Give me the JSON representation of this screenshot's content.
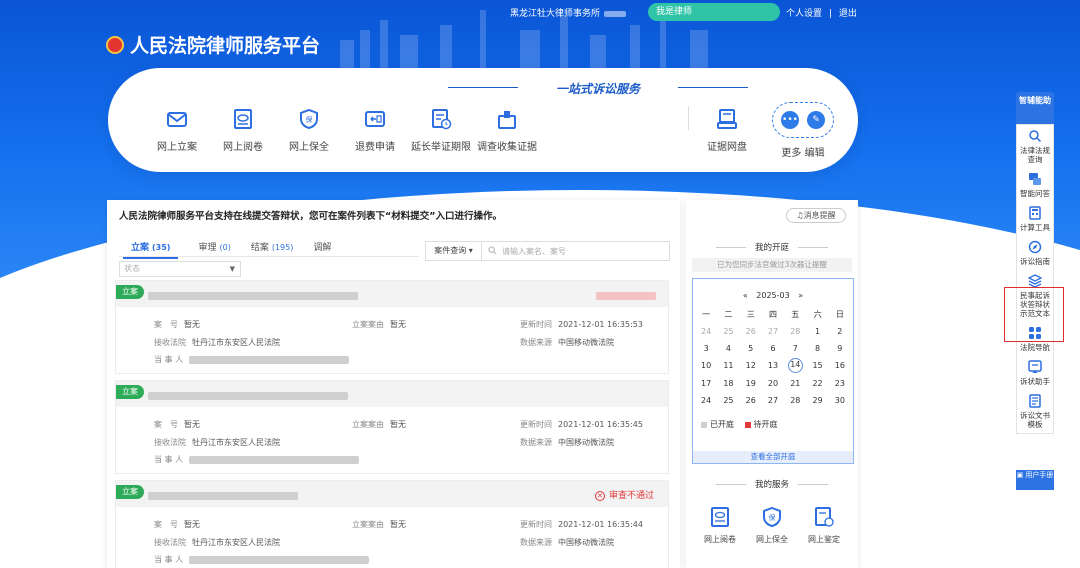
{
  "topbar": {
    "firm": "黑龙江牡大律师事务所",
    "role_button": "我是律师",
    "links": [
      "个人设置",
      "|",
      "退出"
    ]
  },
  "brand": {
    "title": "人民法院律师服务平台"
  },
  "services_card": {
    "slogan": "一站式诉讼服务",
    "items": [
      {
        "label": "网上立案",
        "icon": "envelope-icon"
      },
      {
        "label": "网上阅卷",
        "icon": "eye-document-icon"
      },
      {
        "label": "网上保全",
        "icon": "shield-icon"
      },
      {
        "label": "退费申请",
        "icon": "refund-icon"
      },
      {
        "label": "延长举证期限",
        "icon": "calendar-clock-icon"
      },
      {
        "label": "调查收集证据",
        "icon": "collect-evidence-icon"
      },
      {
        "label": "证据网盘",
        "icon": "cloud-disk-icon"
      }
    ],
    "more_label": "更多",
    "edit_label": "编辑"
  },
  "left_panel": {
    "notice": "人民法院律师服务平台支持在线提交答辩状，您可在案件列表下“材料提交”入口进行操作。",
    "tabs": [
      {
        "label": "立案",
        "count": "(35)"
      },
      {
        "label": "审理",
        "count": "(0)"
      },
      {
        "label": "结案",
        "count": "(195)"
      },
      {
        "label": "调解",
        "count": ""
      }
    ],
    "status_placeholder": "状态",
    "search_type": "案件查询 ▾",
    "search_placeholder": "请输入案名、案号",
    "field_labels": {
      "case_no": "案　号",
      "reason": "立案案由",
      "updated": "更新时间",
      "court": "接收法院",
      "source": "数据来源",
      "party": "当 事 人"
    },
    "cases": [
      {
        "badge": "立案",
        "case_no": "暂无",
        "reason": "暂无",
        "updated": "2021-12-01 16:35:53",
        "court": "牡丹江市东安区人民法院",
        "source": "中国移动微法院",
        "status": ""
      },
      {
        "badge": "立案",
        "case_no": "暂无",
        "reason": "暂无",
        "updated": "2021-12-01 16:35:45",
        "court": "牡丹江市东安区人民法院",
        "source": "中国移动微法院",
        "status": ""
      },
      {
        "badge": "立案",
        "case_no": "暂无",
        "reason": "暂无",
        "updated": "2021-12-01 16:35:44",
        "court": "牡丹江市东安区人民法院",
        "source": "中国移动微法院",
        "status": "审查不通过"
      }
    ]
  },
  "right_panel": {
    "message_button": "消息提醒",
    "hearing_title": "我的开庭",
    "hearing_note": "已为您同步法官做过3次器让提醒",
    "calendar": {
      "prev": "«",
      "month": "2025-03",
      "next": "»",
      "weekdays": [
        "一",
        "二",
        "三",
        "四",
        "五",
        "六",
        "日"
      ],
      "days": [
        "24",
        "25",
        "26",
        "27",
        "28",
        "1",
        "2",
        "3",
        "4",
        "5",
        "6",
        "7",
        "8",
        "9",
        "10",
        "11",
        "12",
        "13",
        "14",
        "15",
        "16",
        "17",
        "18",
        "19",
        "20",
        "21",
        "22",
        "23",
        "24",
        "25",
        "26",
        "27",
        "28",
        "29",
        "30"
      ],
      "today": "14",
      "legend_open": "已开庭",
      "legend_pending": "待开庭",
      "view_all": "查看全部开庭"
    },
    "services_title": "我的服务",
    "services": [
      {
        "label": "网上阅卷",
        "icon": "read-file-icon"
      },
      {
        "label": "网上保全",
        "icon": "shield-icon"
      },
      {
        "label": "网上鉴定",
        "icon": "appraisal-icon"
      }
    ]
  },
  "sidebar": {
    "head": "智辅能助",
    "items": [
      {
        "label": "法律法规查询",
        "icon": "search-icon"
      },
      {
        "label": "智能问答",
        "icon": "chat-icon"
      },
      {
        "label": "计算工具",
        "icon": "calculator-icon"
      },
      {
        "label": "诉讼指南",
        "icon": "compass-icon"
      },
      {
        "label": "民事起诉状答辩状示范文本",
        "icon": "layers-icon"
      },
      {
        "label": "法院导航",
        "icon": "grid-icon"
      },
      {
        "label": "诉状助手",
        "icon": "assistant-icon"
      },
      {
        "label": "诉讼文书模板",
        "icon": "template-icon"
      }
    ],
    "manual": "用户手册"
  },
  "colors": {
    "primary": "#1571ee",
    "accent_teal": "#2fc4a8",
    "badge_green": "#2dab58",
    "danger": "#e03a3a"
  }
}
